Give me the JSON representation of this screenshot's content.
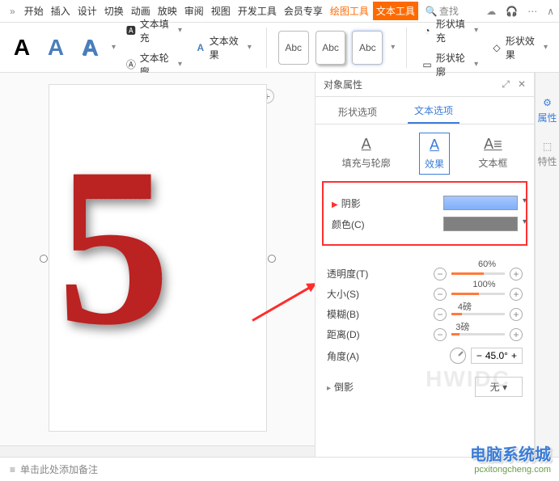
{
  "menu": {
    "items": [
      "开始",
      "插入",
      "设计",
      "切换",
      "动画",
      "放映",
      "审阅",
      "视图",
      "开发工具",
      "会员专享"
    ],
    "drawing": "绘图工具",
    "text": "文本工具",
    "search": "查找"
  },
  "ribbon": {
    "fill": "文本填充",
    "outline": "文本轮廓",
    "effects": "文本效果",
    "abc": "Abc",
    "shapefill": "形状填充",
    "shapeoutline": "形状轮廓",
    "shapeeffects": "形状效果"
  },
  "panel": {
    "title": "对象属性",
    "tabs": {
      "shape": "形状选项",
      "text": "文本选项"
    },
    "sub": {
      "fill": "填充与轮廓",
      "fx": "效果",
      "textbox": "文本框"
    },
    "shadow": {
      "heading": "阴影",
      "color": "颜色(C)",
      "opacity": "透明度(T)",
      "size": "大小(S)",
      "blur": "模糊(B)",
      "distance": "距离(D)",
      "angle": "角度(A)"
    },
    "vals": {
      "opacity": "60%",
      "size": "100%",
      "blur": "4磅",
      "distance": "3磅",
      "angle": "45.0°"
    },
    "reflect": "倒影",
    "none": "无"
  },
  "side": {
    "props": "属性",
    "traits": "特性"
  },
  "notes": "单击此处添加备注",
  "wm": {
    "t1": "电脑系统城",
    "t2": "pcxitongcheng.com",
    "hw": "HWIDC"
  },
  "glyph": "5"
}
